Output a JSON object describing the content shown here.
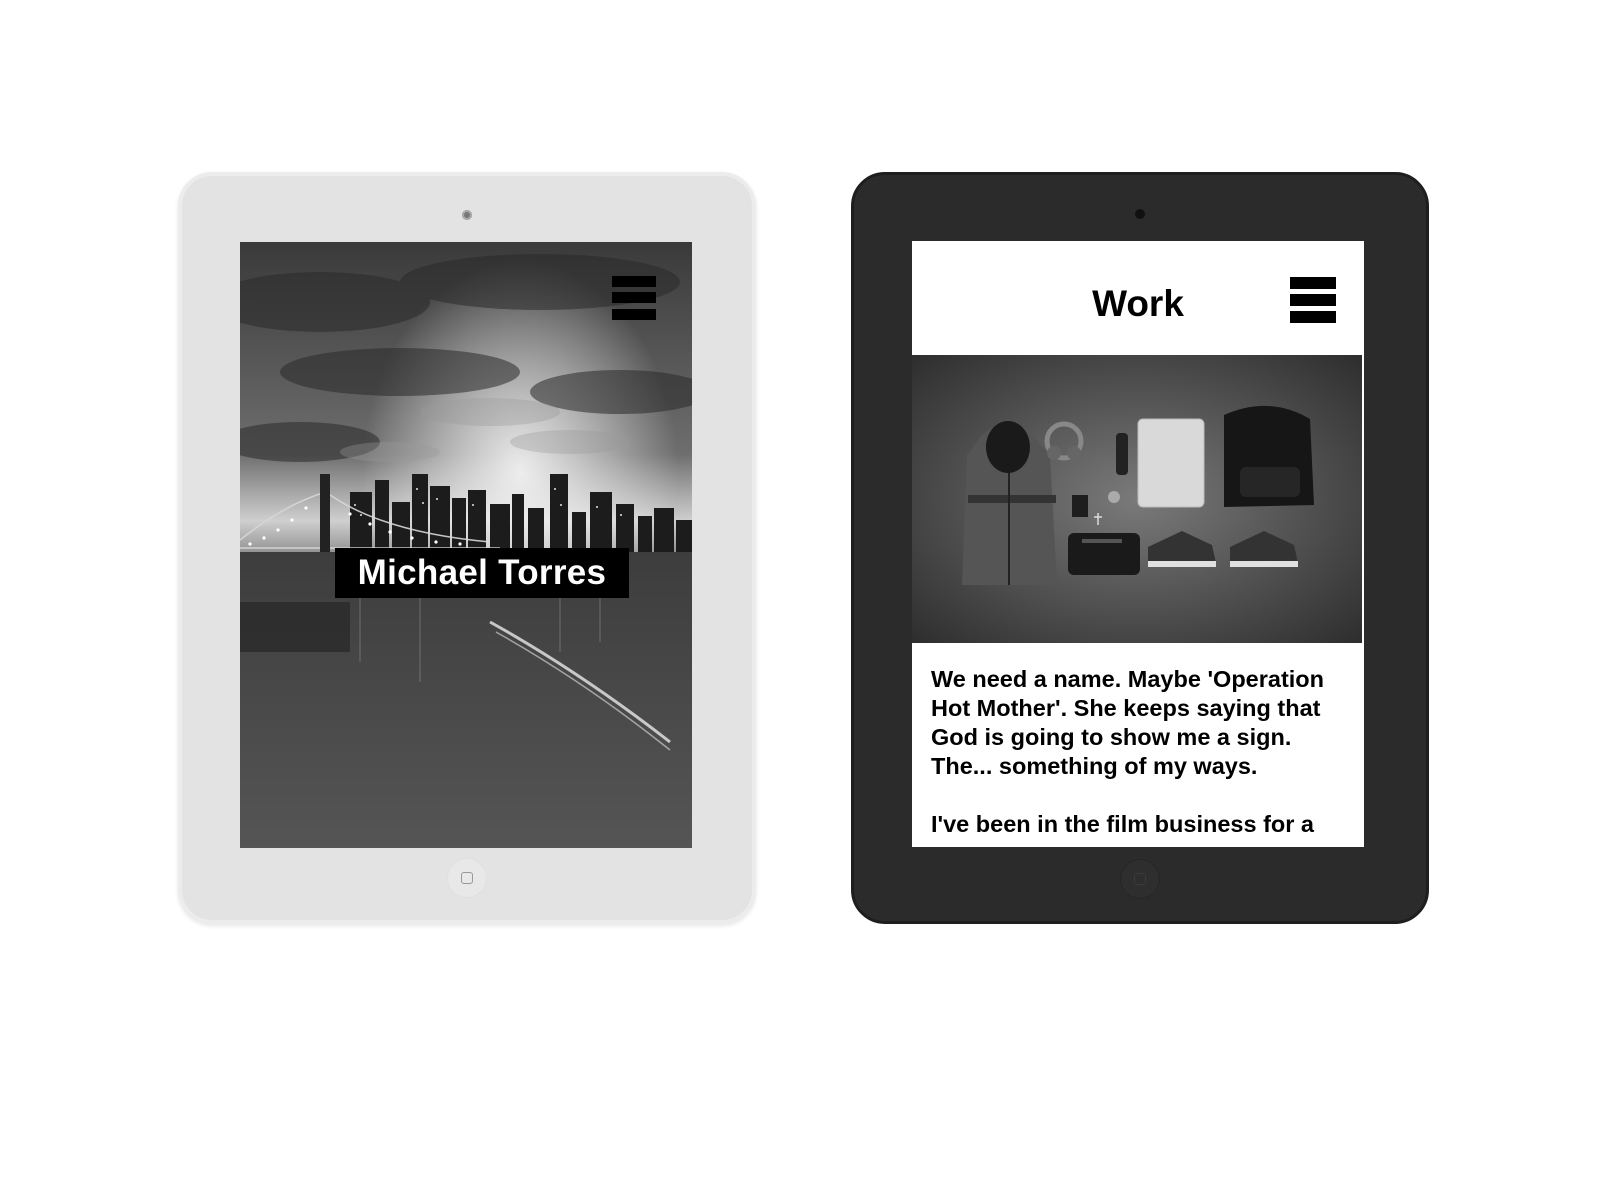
{
  "left_device": {
    "frame_color": "#e3e3e3",
    "hero_name": "Michael Torres",
    "menu_icon": "hamburger-menu-icon"
  },
  "right_device": {
    "frame_color": "#2b2b2b",
    "header_title": "Work",
    "menu_icon": "hamburger-menu-icon",
    "paragraphs": [
      "We need a name. Maybe 'Operation Hot Mother'. She keeps saying that God is going to show me a sign. The... something of my ways.",
      "I've been in the film business for a"
    ]
  }
}
